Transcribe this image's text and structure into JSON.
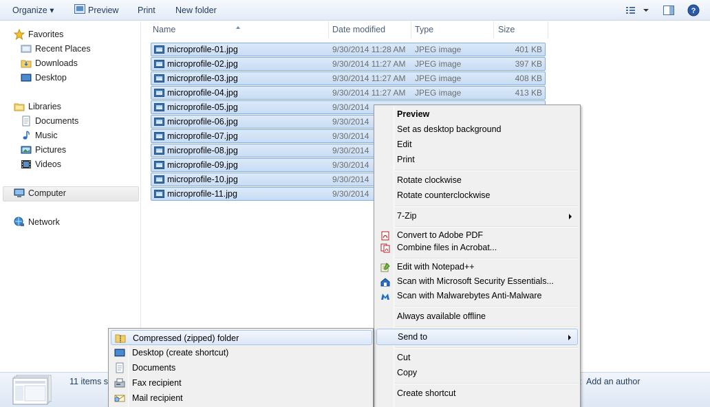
{
  "toolbar": {
    "organize": "Organize ▾",
    "preview": "Preview",
    "print": "Print",
    "new_folder": "New folder"
  },
  "nav": {
    "favorites": "Favorites",
    "recent_places": "Recent Places",
    "downloads": "Downloads",
    "desktop": "Desktop",
    "libraries": "Libraries",
    "documents": "Documents",
    "music": "Music",
    "pictures": "Pictures",
    "videos": "Videos",
    "computer": "Computer",
    "network": "Network"
  },
  "columns": {
    "name": "Name",
    "date_modified": "Date modified",
    "type": "Type",
    "size": "Size"
  },
  "files": [
    {
      "name": "microprofile-01.jpg",
      "date": "9/30/2014 11:28 AM",
      "type": "JPEG image",
      "size": "401 KB"
    },
    {
      "name": "microprofile-02.jpg",
      "date": "9/30/2014 11:27 AM",
      "type": "JPEG image",
      "size": "397 KB"
    },
    {
      "name": "microprofile-03.jpg",
      "date": "9/30/2014 11:27 AM",
      "type": "JPEG image",
      "size": "408 KB"
    },
    {
      "name": "microprofile-04.jpg",
      "date": "9/30/2014 11:27 AM",
      "type": "JPEG image",
      "size": "413 KB"
    },
    {
      "name": "microprofile-05.jpg",
      "date": "9/30/2014"
    },
    {
      "name": "microprofile-06.jpg",
      "date": "9/30/2014"
    },
    {
      "name": "microprofile-07.jpg",
      "date": "9/30/2014"
    },
    {
      "name": "microprofile-08.jpg",
      "date": "9/30/2014"
    },
    {
      "name": "microprofile-09.jpg",
      "date": "9/30/2014"
    },
    {
      "name": "microprofile-10.jpg",
      "date": "9/30/2014"
    },
    {
      "name": "microprofile-11.jpg",
      "date": "9/30/2014"
    }
  ],
  "details": {
    "items_selected": "11 items s",
    "author_label": ":",
    "author_value": "Add an author"
  },
  "context_menu": {
    "preview": "Preview",
    "set_background": "Set as desktop background",
    "edit": "Edit",
    "print": "Print",
    "rotate_cw": "Rotate clockwise",
    "rotate_ccw": "Rotate counterclockwise",
    "seven_zip": "7-Zip",
    "convert_pdf": "Convert to Adobe PDF",
    "combine_acrobat": "Combine files in Acrobat...",
    "edit_notepad": "Edit with Notepad++",
    "scan_mse": "Scan with Microsoft Security Essentials...",
    "scan_mbam": "Scan with Malwarebytes Anti-Malware",
    "offline": "Always available offline",
    "send_to": "Send to",
    "cut": "Cut",
    "copy": "Copy",
    "create_shortcut": "Create shortcut"
  },
  "send_to_menu": {
    "zip": "Compressed (zipped) folder",
    "desktop": "Desktop (create shortcut)",
    "documents": "Documents",
    "fax": "Fax recipient",
    "mail": "Mail recipient"
  },
  "colors": {
    "selection_fill": "#cfe1f6",
    "selection_border": "#84acdd",
    "toolbar_text": "#1e395b"
  }
}
